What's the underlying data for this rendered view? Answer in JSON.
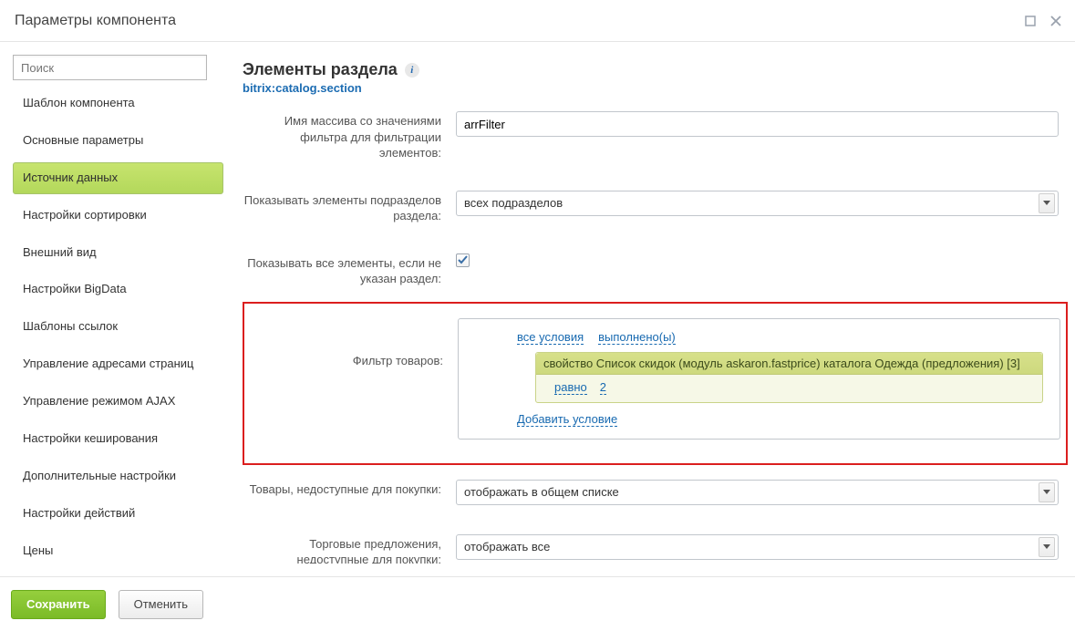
{
  "title": "Параметры компонента",
  "search_placeholder": "Поиск",
  "sidebar": {
    "items": [
      {
        "label": "Шаблон компонента",
        "active": false
      },
      {
        "label": "Основные параметры",
        "active": false
      },
      {
        "label": "Источник данных",
        "active": true
      },
      {
        "label": "Настройки сортировки",
        "active": false
      },
      {
        "label": "Внешний вид",
        "active": false
      },
      {
        "label": "Настройки BigData",
        "active": false
      },
      {
        "label": "Шаблоны ссылок",
        "active": false
      },
      {
        "label": "Управление адресами страниц",
        "active": false
      },
      {
        "label": "Управление режимом AJAX",
        "active": false
      },
      {
        "label": "Настройки кеширования",
        "active": false
      },
      {
        "label": "Дополнительные настройки",
        "active": false
      },
      {
        "label": "Настройки действий",
        "active": false
      },
      {
        "label": "Цены",
        "active": false
      }
    ]
  },
  "header": {
    "title": "Элементы раздела",
    "component": "bitrix:catalog.section"
  },
  "rows": {
    "filter_name": {
      "label": "Имя массива со значениями фильтра для фильтрации элементов:",
      "value": "arrFilter"
    },
    "subsections": {
      "label": "Показывать элементы подразделов раздела:",
      "value": "всех подразделов"
    },
    "show_all": {
      "label": "Показывать все элементы, если не указан раздел:",
      "checked": true
    },
    "product_filter": {
      "label": "Фильтр товаров:",
      "cond_all": "все условия",
      "cond_done": "выполнено(ы)",
      "property": "свойство Список скидок (модуль askaron.fastprice) каталога Одежда (предложения) [3]",
      "op": "равно",
      "value": "2",
      "add": "Добавить условие"
    },
    "unavailable": {
      "label": "Товары, недоступные для покупки:",
      "value": "отображать в общем списке"
    },
    "offers_unavailable": {
      "label": "Торговые предложения, недоступные для покупки:",
      "value": "отображать все"
    }
  },
  "footer": {
    "save": "Сохранить",
    "cancel": "Отменить"
  }
}
